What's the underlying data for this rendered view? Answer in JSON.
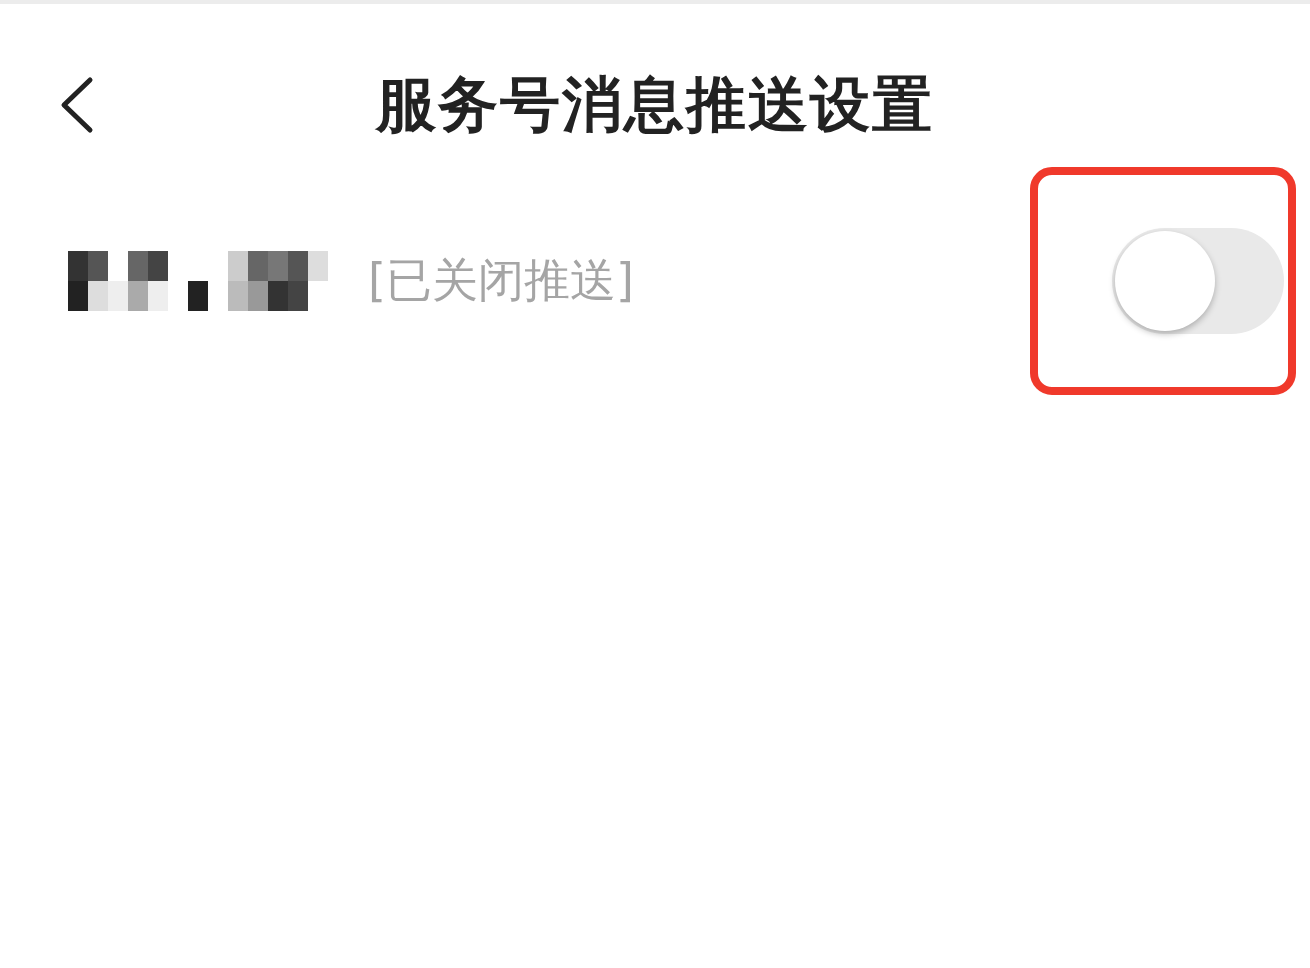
{
  "header": {
    "title": "服务号消息推送设置"
  },
  "rows": [
    {
      "status": "[已关闭推送]",
      "on": false,
      "highlighted": true
    }
  ]
}
